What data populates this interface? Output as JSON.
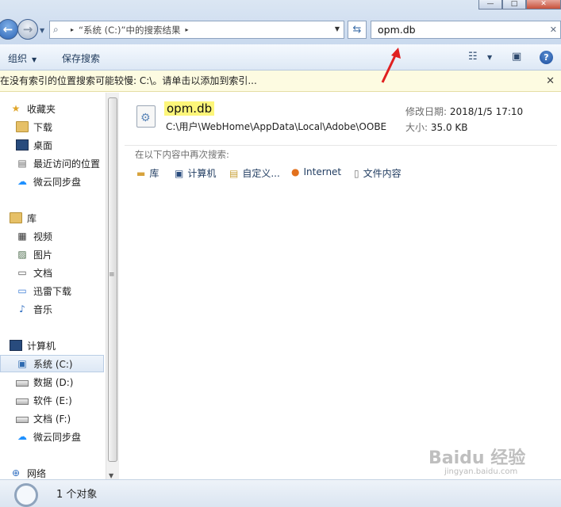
{
  "window": {
    "controls": [
      "—",
      "□",
      "✕"
    ]
  },
  "address": {
    "path_prefix": "▸",
    "path": "“系统 (C:)”中的搜索结果",
    "path_suffix": "▸",
    "search_value": "opm.db"
  },
  "toolbar": {
    "organize": "组织",
    "save_search": "保存搜索"
  },
  "infobar": {
    "text": "在没有索引的位置搜索可能较慢: C:\\。请单击以添加到索引..."
  },
  "nav": {
    "favorites_header": "收藏夹",
    "favorites": [
      "下载",
      "桌面",
      "最近访问的位置",
      "微云同步盘"
    ],
    "libraries_header": "库",
    "libraries": [
      "视频",
      "图片",
      "文档",
      "迅雷下载",
      "音乐"
    ],
    "computer_header": "计算机",
    "drives": [
      "系统 (C:)",
      "数据 (D:)",
      "软件 (E:)",
      "文档 (F:)",
      "微云同步盘"
    ],
    "network_header": "网络"
  },
  "result": {
    "name": "opm.db",
    "path": "C:\\用户\\WebHome\\AppData\\Local\\Adobe\\OOBE",
    "modified_label": "修改日期:",
    "modified_value": "2018/1/5 17:10",
    "size_label": "大小:",
    "size_value": "35.0 KB"
  },
  "search_again": {
    "label": "在以下内容中再次搜索:",
    "locations": [
      "库",
      "计算机",
      "自定义...",
      "Internet",
      "文件内容"
    ]
  },
  "status": {
    "count": "1 个对象"
  },
  "watermark": {
    "brand": "Baidu 经验",
    "url": "jingyan.baidu.com"
  },
  "colors": {
    "infobar_bg": "#fdfbe1",
    "highlight": "#fdf67a",
    "arrow": "#e02020"
  }
}
